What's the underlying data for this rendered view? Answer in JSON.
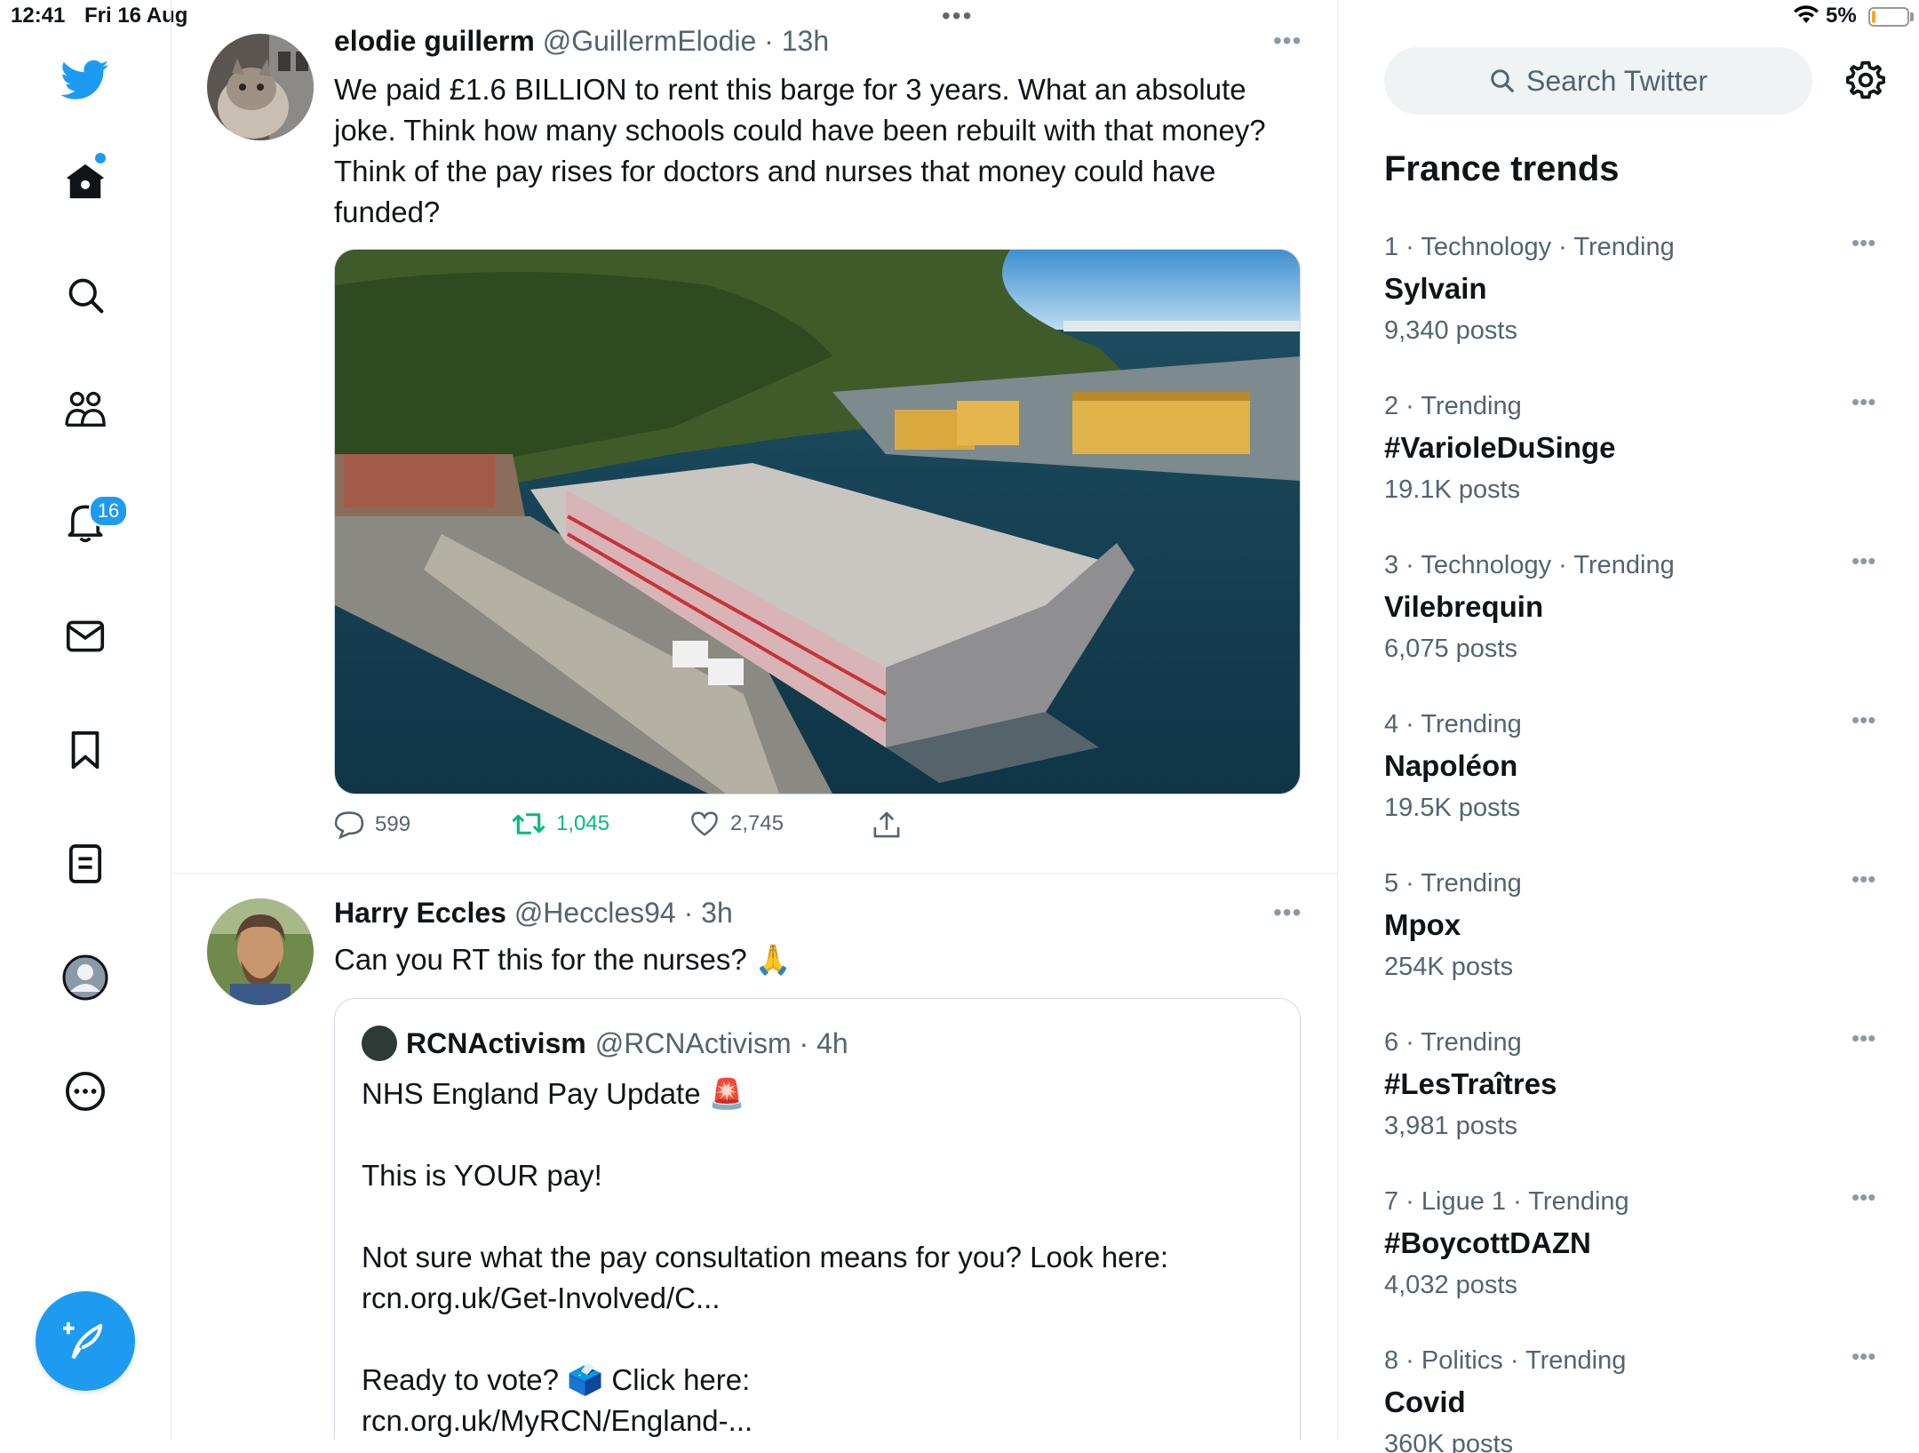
{
  "status_bar": {
    "time": "12:41",
    "date": "Fri 16 Aug",
    "battery": "5%"
  },
  "sidebar": {
    "notifications_badge": "16"
  },
  "tweets": [
    {
      "name": "elodie guillerm",
      "meta": "@GuillermElodie · 13h",
      "text": "We paid £1.6 BILLION to rent this barge for 3 years. What an absolute joke. Think how many schools could have been rebuilt with that money? Think of the pay rises for doctors and nurses that money could have funded?",
      "replies": "599",
      "retweets": "1,045",
      "likes": "2,745"
    },
    {
      "name": "Harry Eccles",
      "meta": "@Heccles94 · 3h",
      "text": "Can you RT this for the nurses? 🙏",
      "quote": {
        "name": "RCNActivism",
        "meta": "@RCNActivism · 4h",
        "line1": "NHS England Pay Update 🚨",
        "line2": "This is YOUR pay!",
        "line3": "Not sure what the pay consultation means for you? Look here:",
        "line4": "rcn.org.uk/Get-Involved/C...",
        "line5": "Ready to vote? 🗳️ Click here:",
        "line6": "rcn.org.uk/MyRCN/England-..."
      }
    }
  ],
  "right_panel": {
    "search_placeholder": "Search Twitter",
    "trends_title": "France trends",
    "trends": [
      {
        "meta": "1 · Technology · Trending",
        "name": "Sylvain",
        "count": "9,340 posts"
      },
      {
        "meta": "2 · Trending",
        "name": "#VarioleDuSinge",
        "count": "19.1K posts"
      },
      {
        "meta": "3 · Technology · Trending",
        "name": "Vilebrequin",
        "count": "6,075 posts"
      },
      {
        "meta": "4 · Trending",
        "name": "Napoléon",
        "count": "19.5K posts"
      },
      {
        "meta": "5 · Trending",
        "name": "Mpox",
        "count": "254K posts"
      },
      {
        "meta": "6 · Trending",
        "name": "#LesTraîtres",
        "count": "3,981 posts"
      },
      {
        "meta": "7 · Ligue 1 · Trending",
        "name": "#BoycottDAZN",
        "count": "4,032 posts"
      },
      {
        "meta": "8 · Politics · Trending",
        "name": "Covid",
        "count": "360K posts"
      }
    ]
  }
}
